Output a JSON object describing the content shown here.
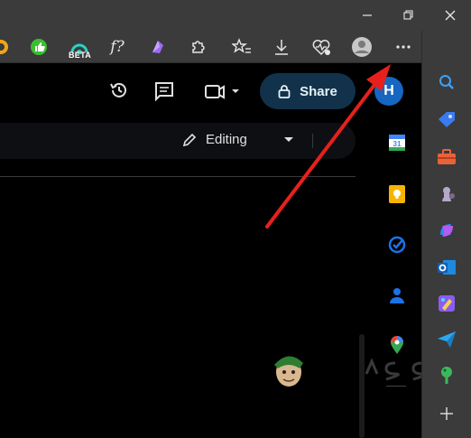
{
  "window": {
    "controls": [
      "minimize-icon",
      "restore-icon",
      "close-icon"
    ]
  },
  "toolbar": {
    "icons": [
      "extension-orange-icon",
      "thumbs-up-icon",
      "beta-extension-icon",
      "function-icon",
      "purple-extension-icon",
      "extensions-icon",
      "favorites-icon",
      "downloads-icon",
      "browser-essentials-icon",
      "profile-icon",
      "more-icon",
      "bing-copilot-icon"
    ],
    "beta_label": "BETA",
    "function_label": "f?"
  },
  "docs": {
    "share_label": "Share",
    "avatar_letter": "H",
    "mode_label": "Editing",
    "calendar_day": "31"
  },
  "colors": {
    "chrome": "#3b3b3b",
    "share_bg": "#11324a",
    "avatar": "#1766c2",
    "arrow": "#e8201c"
  }
}
